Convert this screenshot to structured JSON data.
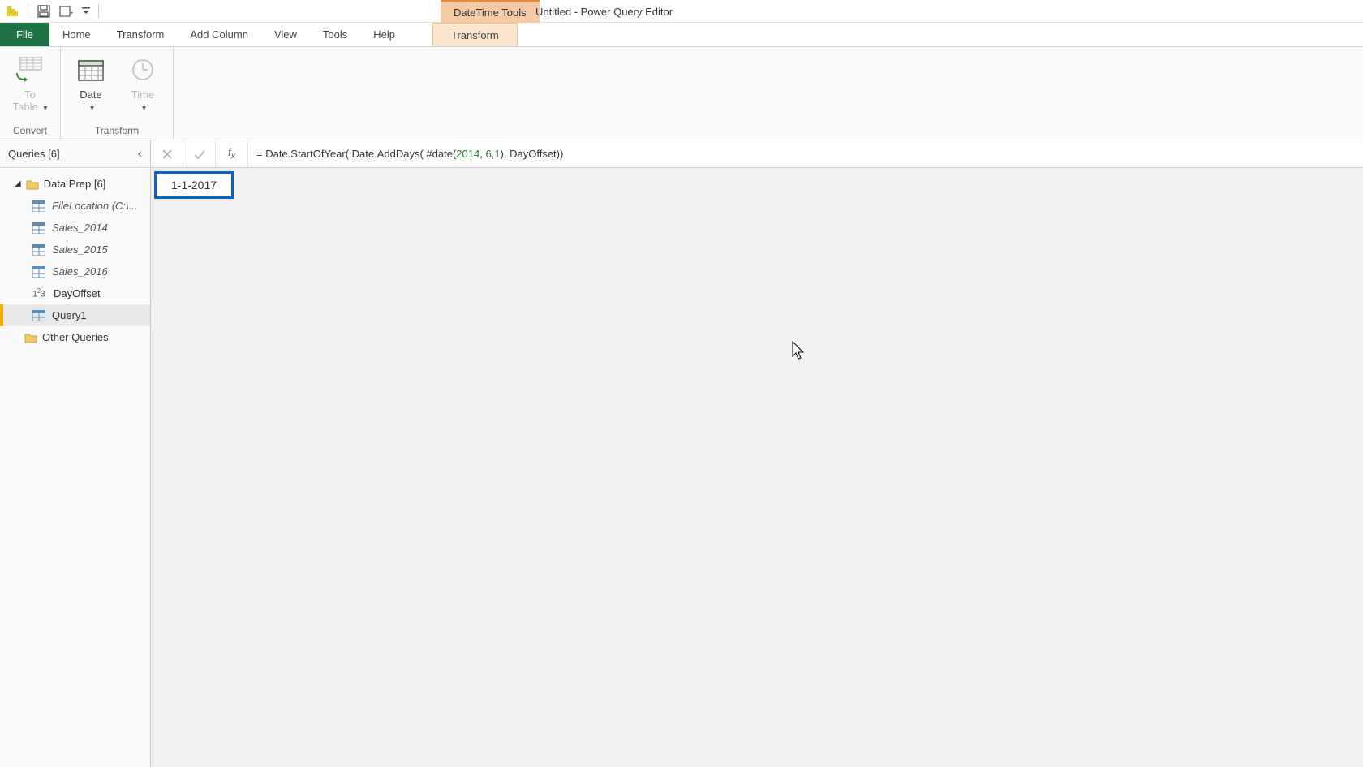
{
  "titlebar": {
    "context_tool_label": "DateTime Tools",
    "document_title": "Untitled - Power Query Editor"
  },
  "tabs": {
    "file": "File",
    "home": "Home",
    "transform": "Transform",
    "add_column": "Add Column",
    "view": "View",
    "tools": "Tools",
    "help": "Help",
    "context_transform": "Transform"
  },
  "ribbon": {
    "group_convert": "Convert",
    "group_transform": "Transform",
    "to_table": "To\nTable",
    "date": "Date",
    "time": "Time"
  },
  "queries_pane": {
    "header": "Queries [6]",
    "group_data_prep": "Data Prep [6]",
    "items": [
      {
        "label": "FileLocation (C:\\...",
        "icon": "table",
        "italic": true
      },
      {
        "label": "Sales_2014",
        "icon": "table",
        "italic": true
      },
      {
        "label": "Sales_2015",
        "icon": "table",
        "italic": true
      },
      {
        "label": "Sales_2016",
        "icon": "table",
        "italic": true
      },
      {
        "label": "DayOffset",
        "icon": "num",
        "italic": false
      },
      {
        "label": "Query1",
        "icon": "table",
        "italic": false,
        "selected": true
      }
    ],
    "group_other": "Other Queries"
  },
  "formula": {
    "prefix": "= Date.StartOfYear( Date.AddDays( #date(",
    "n1": "2014",
    "sep1": ", ",
    "n2": "6",
    "sep2": ",",
    "n3": "1",
    "suffix": "), DayOffset))"
  },
  "result": {
    "value": "1-1-2017"
  }
}
